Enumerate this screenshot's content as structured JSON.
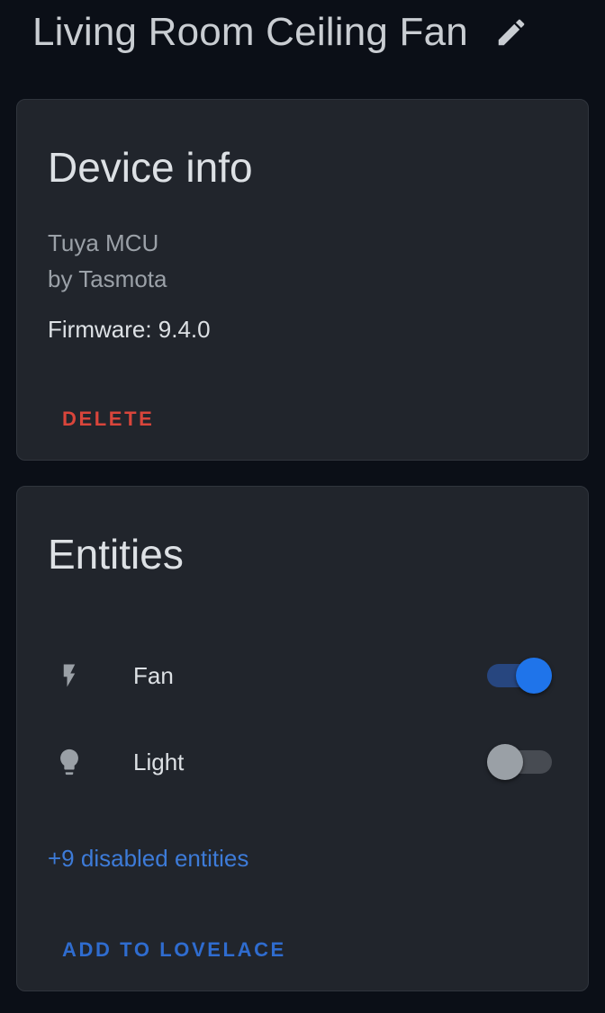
{
  "header": {
    "title": "Living Room Ceiling Fan",
    "edit_icon": "pencil-icon"
  },
  "device_info": {
    "heading": "Device info",
    "model": "Tuya MCU",
    "manufacturer": "by Tasmota",
    "firmware": "Firmware: 9.4.0",
    "delete_label": "DELETE"
  },
  "entities": {
    "heading": "Entities",
    "items": [
      {
        "name": "Fan",
        "icon": "flash-icon",
        "state": "on"
      },
      {
        "name": "Light",
        "icon": "lightbulb-icon",
        "state": "off"
      }
    ],
    "disabled_link": "+9 disabled entities",
    "add_label": "ADD TO LOVELACE"
  },
  "colors": {
    "background": "#0b0f17",
    "card": "#21252c",
    "delete": "#d9453b",
    "accent": "#1f74ea",
    "link": "#3d7bd8"
  }
}
